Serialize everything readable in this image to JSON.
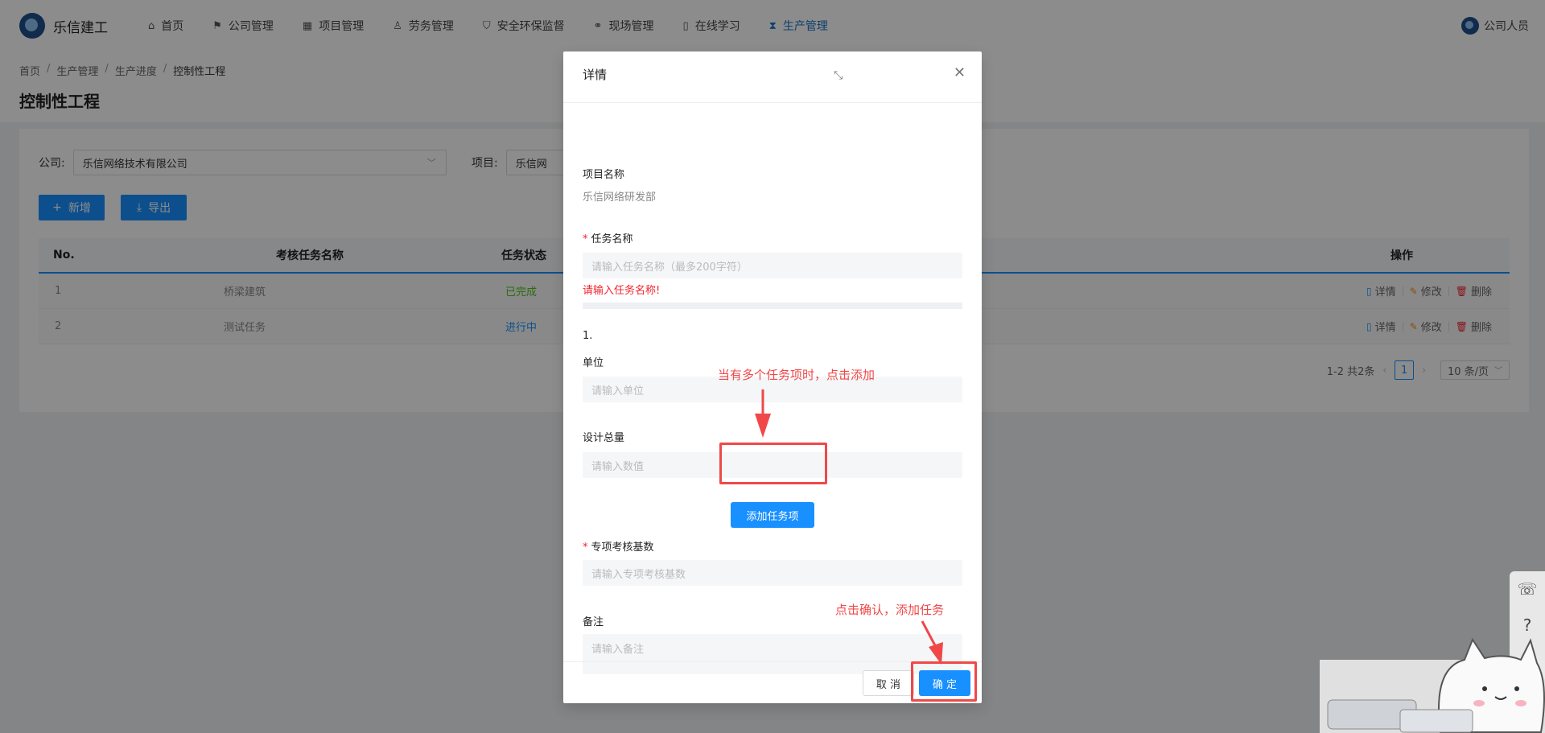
{
  "app": {
    "name": "乐信建工",
    "user": "公司人员"
  },
  "nav": [
    {
      "label": "首页",
      "icon": "home-icon",
      "glyph": "⌂"
    },
    {
      "label": "公司管理",
      "icon": "flag-icon",
      "glyph": "⚑"
    },
    {
      "label": "项目管理",
      "icon": "project-icon",
      "glyph": "▦"
    },
    {
      "label": "劳务管理",
      "icon": "people-icon",
      "glyph": "♙"
    },
    {
      "label": "安全环保监督",
      "icon": "shield-icon",
      "glyph": "⛉"
    },
    {
      "label": "现场管理",
      "icon": "site-icon",
      "glyph": "⚭"
    },
    {
      "label": "在线学习",
      "icon": "book-icon",
      "glyph": "▯"
    },
    {
      "label": "生产管理",
      "icon": "hourglass-icon",
      "glyph": "⧗"
    }
  ],
  "breadcrumb": [
    "首页",
    "生产管理",
    "生产进度",
    "控制性工程"
  ],
  "page": {
    "title": "控制性工程"
  },
  "filters": {
    "company_label": "公司:",
    "company_value": "乐信网络技术有限公司",
    "project_label": "项目:",
    "project_value": "乐信网"
  },
  "toolbar": {
    "add": "新增",
    "export": "导出"
  },
  "table": {
    "headers": [
      "No.",
      "考核任务名称",
      "任务状态",
      "操作"
    ],
    "rows": [
      {
        "no": "1",
        "name": "桥梁建筑",
        "state": "已完成"
      },
      {
        "no": "2",
        "name": "测试任务",
        "state": "进行中"
      }
    ],
    "ops": [
      "详情",
      "修改",
      "删除"
    ]
  },
  "pager": {
    "summary": "1-2 共2条",
    "current": "1",
    "size": "10 条/页"
  },
  "modal": {
    "title": "详情",
    "project_label": "项目名称",
    "project_value": "乐信网络研发部",
    "task_label": "任务名称",
    "task_placeholder": "请输入任务名称（最多200字符）",
    "task_error": "请输入任务名称!",
    "item_index": "1.",
    "unit_label": "单位",
    "unit_placeholder": "请输入单位",
    "design_label": "设计总量",
    "design_placeholder": "请输入数值",
    "add_item": "添加任务项",
    "base_label": "专项考核基数",
    "base_placeholder": "请输入专项考核基数",
    "remark_label": "备注",
    "remark_placeholder": "请输入备注",
    "cancel": "取 消",
    "ok": "确 定"
  },
  "annotations": {
    "add_hint": "当有多个任务项时，点击添加",
    "ok_hint": "点击确认，添加任务"
  },
  "colors": {
    "primary": "#1890ff",
    "annotation": "#f04848",
    "done": "#52c41a"
  }
}
